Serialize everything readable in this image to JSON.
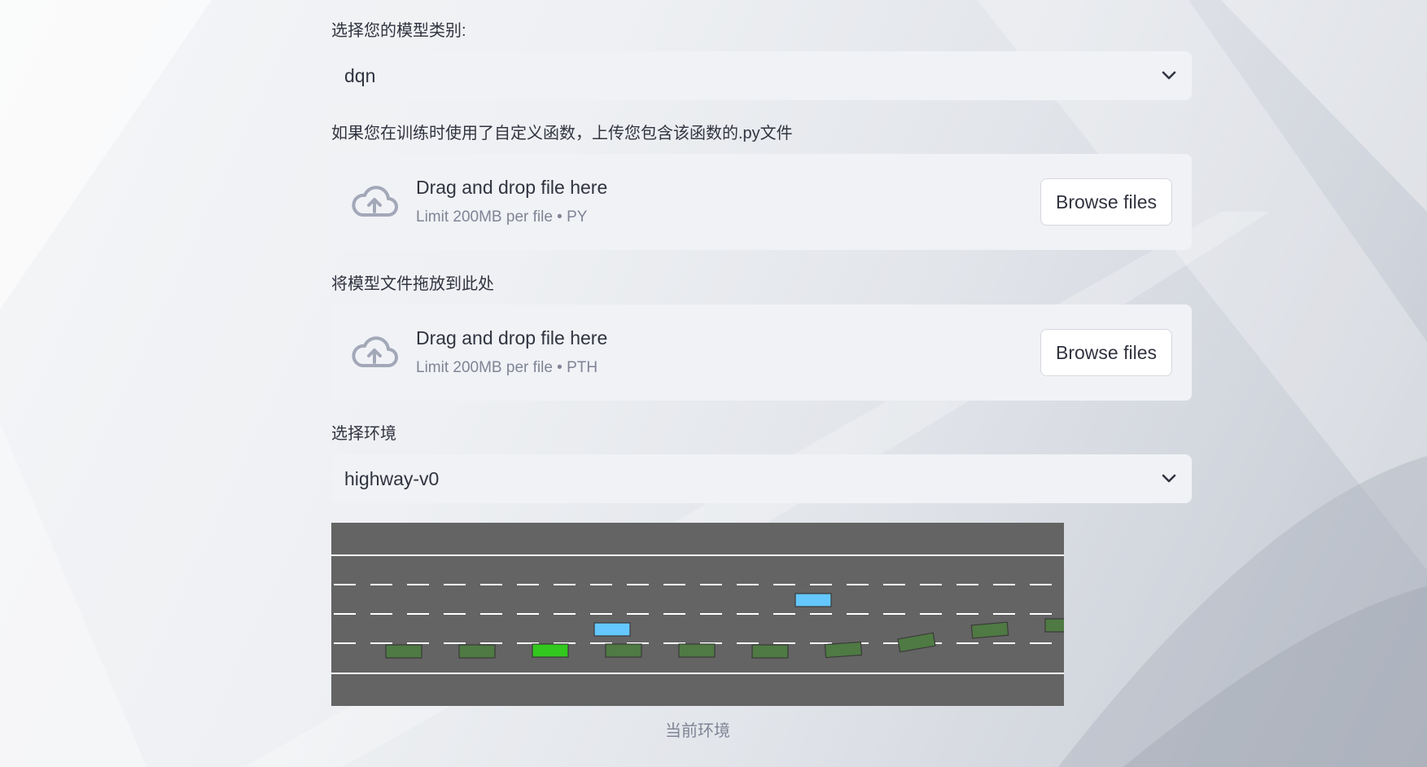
{
  "model_select": {
    "label": "选择您的模型类别:",
    "value": "dqn"
  },
  "custom_func_upload": {
    "label": "如果您在训练时使用了自定义函数，上传您包含该函数的.py文件",
    "drag_text": "Drag and drop file here",
    "limit_text": "Limit 200MB per file • PY",
    "button_label": "Browse files",
    "icon": "cloud-upload-icon"
  },
  "model_file_upload": {
    "label": "将模型文件拖放到此处",
    "drag_text": "Drag and drop file here",
    "limit_text": "Limit 200MB per file • PTH",
    "button_label": "Browse files",
    "icon": "cloud-upload-icon"
  },
  "env_select": {
    "label": "选择环境",
    "value": "highway-v0"
  },
  "env_render": {
    "caption": "当前环境",
    "lanes": 4,
    "colors": {
      "road": "#646464",
      "lane_marking": "#ffffff",
      "ego_vehicle": "#32c81e",
      "other_vehicle": "#4f7a43",
      "highlight_vehicle": "#64c8ff"
    }
  }
}
